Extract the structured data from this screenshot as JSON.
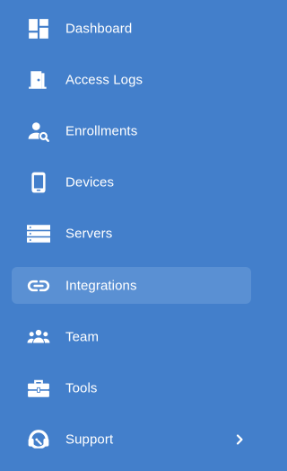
{
  "sidebar": {
    "active_index": 5,
    "items": [
      {
        "label": "Dashboard",
        "icon": "dashboard-icon"
      },
      {
        "label": "Access Logs",
        "icon": "door-icon"
      },
      {
        "label": "Enrollments",
        "icon": "user-search-icon"
      },
      {
        "label": "Devices",
        "icon": "phone-icon"
      },
      {
        "label": "Servers",
        "icon": "server-icon"
      },
      {
        "label": "Integrations",
        "icon": "link-icon"
      },
      {
        "label": "Team",
        "icon": "team-icon"
      },
      {
        "label": "Tools",
        "icon": "toolbox-icon"
      },
      {
        "label": "Support",
        "icon": "headset-icon",
        "has_submenu": true
      }
    ]
  },
  "colors": {
    "background": "#437fcb",
    "active_background": "#5a90d3",
    "text": "#ffffff"
  }
}
